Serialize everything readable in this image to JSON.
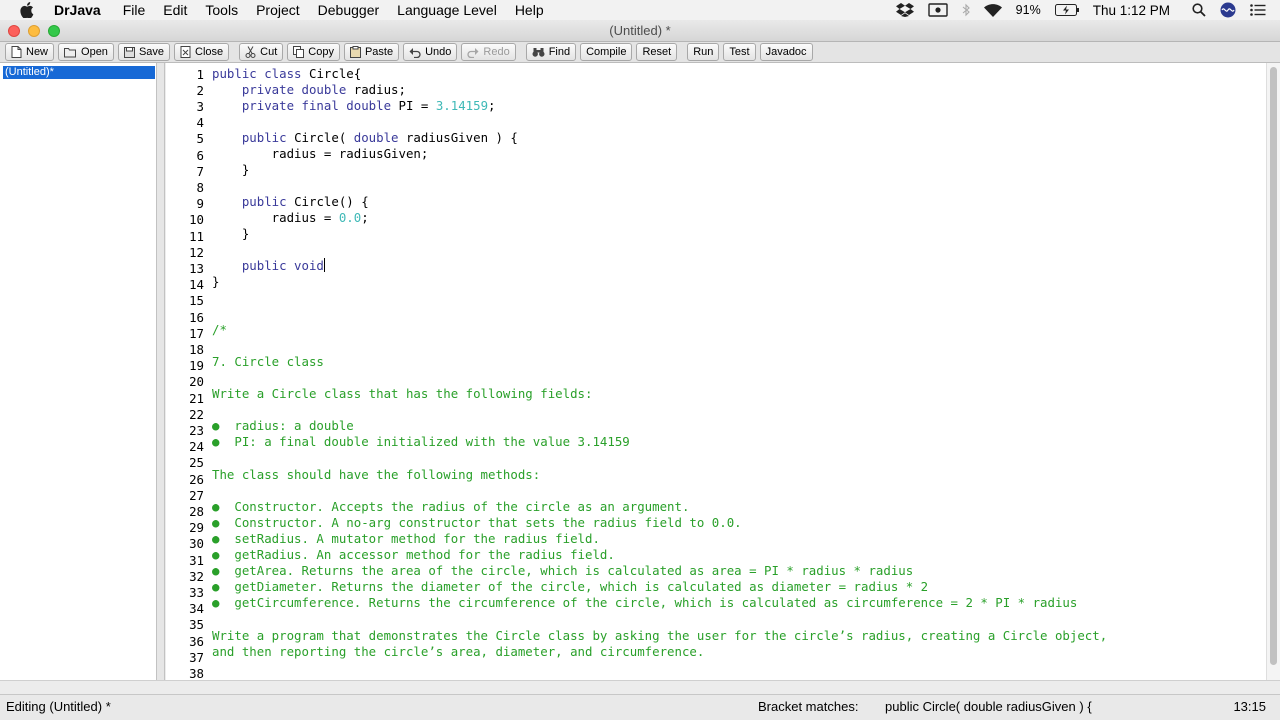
{
  "menubar": {
    "app_name": "DrJava",
    "items": [
      "File",
      "Edit",
      "Tools",
      "Project",
      "Debugger",
      "Language Level",
      "Help"
    ],
    "battery": "91%",
    "clock": "Thu 1:12 PM"
  },
  "window": {
    "title": "(Untitled) *"
  },
  "toolbar": {
    "new": "New",
    "open": "Open",
    "save": "Save",
    "close": "Close",
    "cut": "Cut",
    "copy": "Copy",
    "paste": "Paste",
    "undo": "Undo",
    "redo": "Redo",
    "find": "Find",
    "compile": "Compile",
    "reset": "Reset",
    "run": "Run",
    "test": "Test",
    "javadoc": "Javadoc"
  },
  "files": {
    "current": "(Untitled)*"
  },
  "editor": {
    "line_numbers": [
      "1",
      "2",
      "3",
      "4",
      "5",
      "6",
      "7",
      "8",
      "9",
      "10",
      "11",
      "12",
      "13",
      "14",
      "15",
      "16",
      "17",
      "18",
      "19",
      "20",
      "21",
      "22",
      "23",
      "24",
      "25",
      "26",
      "27",
      "28",
      "29",
      "30",
      "31",
      "32",
      "33",
      "34",
      "35",
      "36",
      "37",
      "38"
    ],
    "code": {
      "l1": {
        "kw": "public class ",
        "id": "Circle{"
      },
      "l2": {
        "kw": "    private double ",
        "id": "radius;"
      },
      "l3": {
        "kw": "    private final double ",
        "id": "PI = ",
        "num": "3.14159",
        "end": ";"
      },
      "l5": {
        "kw": "    public ",
        "id": "Circle( ",
        "kw2": "double ",
        "id2": "radiusGiven ) {"
      },
      "l6": {
        "id": "        radius = radiusGiven;"
      },
      "l7": {
        "id": "    }"
      },
      "l9": {
        "kw": "    public ",
        "id": "Circle() {"
      },
      "l10": {
        "id": "        radius = ",
        "num": "0.0",
        "end": ";"
      },
      "l11": {
        "id": "    }"
      },
      "l13": {
        "kw": "    public void"
      },
      "l14": {
        "id": "}"
      }
    },
    "comment": {
      "l17": "/*",
      "l19": "7. Circle class",
      "l21": "Write a Circle class that has the following fields:",
      "l23": "●  radius: a double",
      "l24": "●  PI: a final double initialized with the value 3.14159",
      "l26": "The class should have the following methods:",
      "l28": "●  Constructor. Accepts the radius of the circle as an argument.",
      "l29": "●  Constructor. A no-arg constructor that sets the radius field to 0.0.",
      "l30": "●  setRadius. A mutator method for the radius field.",
      "l31": "●  getRadius. An accessor method for the radius field.",
      "l32": "●  getArea. Returns the area of the circle, which is calculated as area = PI * radius * radius",
      "l33": "●  getDiameter. Returns the diameter of the circle, which is calculated as diameter = radius * 2",
      "l34": "●  getCircumference. Returns the circumference of the circle, which is calculated as circumference = 2 * PI * radius",
      "l36": "Write a program that demonstrates the Circle class by asking the user for the circle’s radius, creating a Circle object,",
      "l37": "and then reporting the circle’s area, diameter, and circumference."
    }
  },
  "status": {
    "editing": "Editing (Untitled) *",
    "bracket_label": "Bracket matches:",
    "bracket_value": "public Circle( double radiusGiven ) {",
    "position": "13:15"
  },
  "colors": {
    "keyword": "#3a3a9a",
    "number": "#3fb9b7",
    "comment": "#2aa02a",
    "selection": "#1769d6"
  },
  "icons": [
    "apple-icon",
    "dropbox-icon",
    "screen-mirror-icon",
    "bluetooth-icon",
    "wifi-icon",
    "battery-icon",
    "spotlight-icon",
    "siri-icon",
    "notification-list-icon",
    "new-file-icon",
    "open-folder-icon",
    "save-icon",
    "close-file-icon",
    "cut-icon",
    "copy-icon",
    "paste-icon",
    "undo-icon",
    "redo-icon",
    "find-icon"
  ]
}
